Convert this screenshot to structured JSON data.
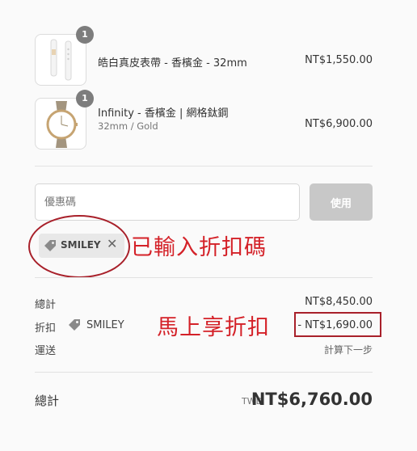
{
  "items": [
    {
      "quantity": "1",
      "name": "皓白真皮表帶 - 香檳金 - 32mm",
      "variant": "",
      "price": "NT$1,550.00",
      "image_icon": "watch-strap-icon"
    },
    {
      "quantity": "1",
      "name": "Infinity - 香檳金 | 網格鈦鋼",
      "variant": "32mm / Gold",
      "price": "NT$6,900.00",
      "image_icon": "watch-icon"
    }
  ],
  "coupon": {
    "placeholder": "優惠碼",
    "apply_label": "使用",
    "applied_code": "SMILEY",
    "remove_symbol": "✕"
  },
  "annotations": {
    "code_entered": "已輸入折扣碼",
    "discount_applied": "馬上享折扣"
  },
  "summary": {
    "subtotal_label": "總計",
    "subtotal_value": "NT$8,450.00",
    "discount_label": "折扣",
    "discount_code": "SMILEY",
    "discount_value": "- NT$1,690.00",
    "shipping_label": "運送",
    "shipping_value": "計算下一步"
  },
  "total": {
    "label": "總計",
    "currency": "TWD",
    "value": "NT$6,760.00"
  },
  "colors": {
    "annotation_red": "#d42128",
    "annotation_outline": "#a8202a",
    "button_disabled": "#c8c8c8"
  }
}
